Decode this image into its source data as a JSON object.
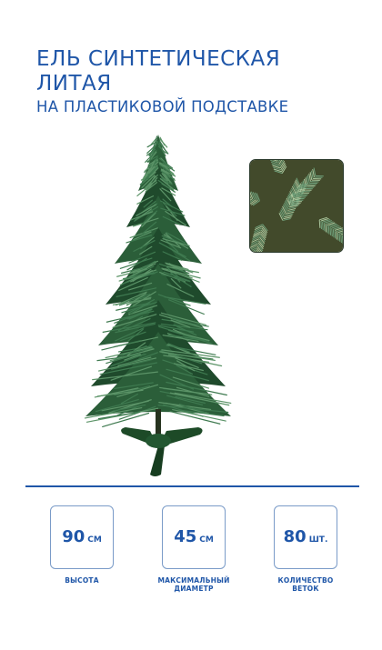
{
  "header": {
    "title_line1": "ЕЛЬ СИНТЕТИЧЕСКАЯ",
    "title_line2": "ЛИТАЯ",
    "subtitle": "НА ПЛАСТИКОВОЙ ПОДСТАВКЕ"
  },
  "colors": {
    "accent": "#1f56a8",
    "box_border": "#7a9bc8",
    "needle_dark": "#1f4a2c",
    "needle_light": "#3f7a50",
    "stand": "#1d4a27"
  },
  "specs": [
    {
      "value": "90",
      "unit": "СМ",
      "label_line1": "ВЫСОТА",
      "label_line2": ""
    },
    {
      "value": "45",
      "unit": "СМ",
      "label_line1": "МАКСИМАЛЬНЫЙ",
      "label_line2": "ДИАМЕТР"
    },
    {
      "value": "80",
      "unit": "ШТ.",
      "label_line1": "КОЛИЧЕСТВО",
      "label_line2": "ВЕТОК"
    }
  ],
  "images": {
    "tree": "artificial-christmas-tree",
    "detail": "needle-closeup"
  }
}
